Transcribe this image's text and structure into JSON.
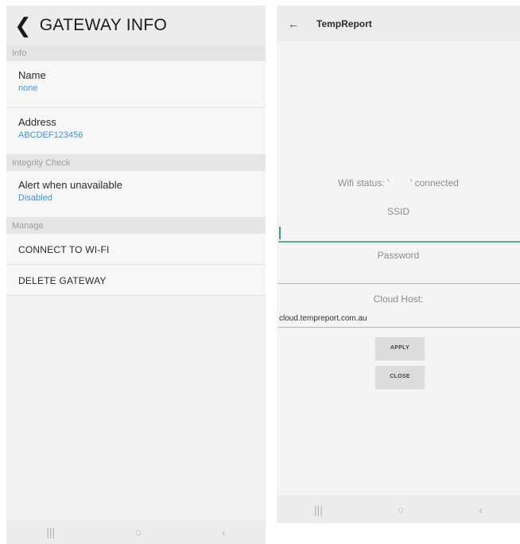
{
  "left": {
    "header": {
      "back_glyph": "❮",
      "title": "GATEWAY INFO"
    },
    "sections": {
      "info": "Info",
      "integrity": "Integrity Check",
      "manage": "Manage"
    },
    "name": {
      "label": "Name",
      "value": "none"
    },
    "address": {
      "label": "Address",
      "value": "ABCDEF123456"
    },
    "alert": {
      "label": "Alert when unavailable",
      "value": "Disabled"
    },
    "actions": {
      "connect": "CONNECT TO WI-FI",
      "delete": "DELETE GATEWAY"
    },
    "navbar": {
      "recents": "|||",
      "home": "○",
      "back": "‹"
    }
  },
  "right": {
    "appbar": {
      "back_glyph": "←",
      "title": "TempReport"
    },
    "wifi_status": "Wifi status: '        ' connected",
    "ssid_label": "SSID",
    "ssid_value": "",
    "password_label": "Password",
    "cloud_host_label": "Cloud Host:",
    "cloud_host_value": "cloud.tempreport.com.au",
    "apply_label": "APPLY",
    "close_label": "CLOSE",
    "navbar": {
      "recents": "|||",
      "home": "○",
      "back": "‹"
    }
  },
  "colors": {
    "accent_link": "#4b8fc2",
    "input_focus": "#5ea79a"
  }
}
